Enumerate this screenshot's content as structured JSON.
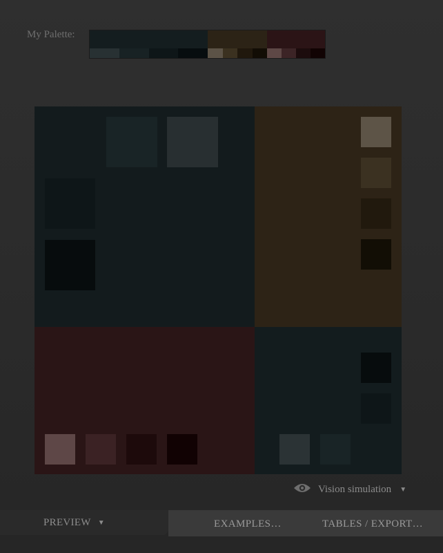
{
  "palette": {
    "label": "My Palette:",
    "groups": [
      {
        "main": "#141d1f",
        "swatches": [
          "#283133",
          "#182224",
          "#0e1618",
          "#070d0f"
        ]
      },
      {
        "main": "#2c2316",
        "swatches": [
          "#5c5347",
          "#3b3120",
          "#20180d",
          "#120d05"
        ]
      },
      {
        "main": "#2b1416",
        "swatches": [
          "#5e4846",
          "#3c2426",
          "#1c0c0d",
          "#110303"
        ]
      }
    ]
  },
  "preview": {
    "panes": [
      {
        "name": "pane-top-left",
        "color": "#131b1d"
      },
      {
        "name": "pane-top-right",
        "color": "#2d2316"
      },
      {
        "name": "pane-bottom-left",
        "color": "#2a1516"
      },
      {
        "name": "pane-bottom-right",
        "color": "#131c1e"
      }
    ],
    "swatches": [
      {
        "name": "swatch-teal-2",
        "color": "#192426"
      },
      {
        "name": "swatch-teal-1",
        "color": "#282f31"
      },
      {
        "name": "swatch-teal-3",
        "color": "#0e1618"
      },
      {
        "name": "swatch-teal-4",
        "color": "#070c0d"
      },
      {
        "name": "swatch-brown-1",
        "color": "#5d5447"
      },
      {
        "name": "swatch-brown-2",
        "color": "#3b3121"
      },
      {
        "name": "swatch-brown-3",
        "color": "#21190d"
      },
      {
        "name": "swatch-brown-4",
        "color": "#120e05"
      },
      {
        "name": "swatch-red-1",
        "color": "#5e4747"
      },
      {
        "name": "swatch-red-2",
        "color": "#3b2224"
      },
      {
        "name": "swatch-red-3",
        "color": "#1d0a0b"
      },
      {
        "name": "swatch-red-4",
        "color": "#110203"
      },
      {
        "name": "swatch-br-teal-4",
        "color": "#070c0d"
      },
      {
        "name": "swatch-br-teal-3",
        "color": "#0e1618"
      },
      {
        "name": "swatch-br-teal-1",
        "color": "#2b3335"
      },
      {
        "name": "swatch-br-teal-2",
        "color": "#192426"
      }
    ]
  },
  "vision": {
    "label": "Vision simulation",
    "icon": "eye-icon",
    "arrow": "▼"
  },
  "tabs": {
    "preview_label": "PREVIEW",
    "preview_arrow": "▼",
    "examples_label": "EXAMPLES…",
    "tables_label": "TABLES / EXPORT…"
  }
}
